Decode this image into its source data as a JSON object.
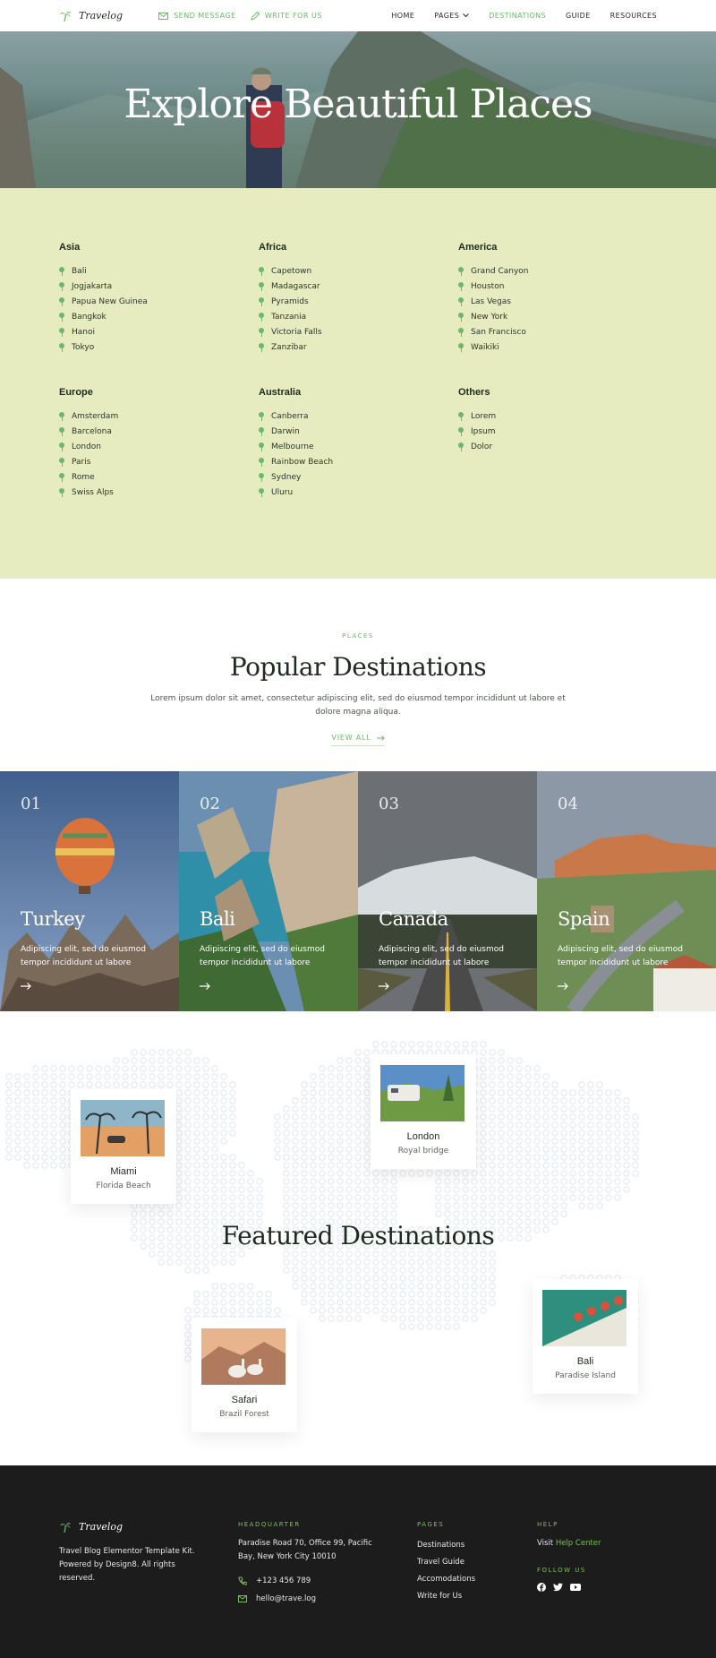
{
  "nav": {
    "brand": "Travelog",
    "actions": [
      {
        "label": "SEND MESSAGE",
        "icon": "envelope-icon"
      },
      {
        "label": "WRITE FOR US",
        "icon": "pencil-icon"
      }
    ],
    "links": [
      "HOME",
      "PAGES",
      "DESTINATIONS",
      "GUIDE",
      "RESOURCES"
    ],
    "active_link": "DESTINATIONS",
    "accent": "#6bb86a"
  },
  "hero": {
    "title": "Explore Beautiful Places"
  },
  "regions": [
    {
      "name": "Asia",
      "places": [
        "Bali",
        "Jogjakarta",
        "Papua New Guinea",
        "Bangkok",
        "Hanoi",
        "Tokyo"
      ]
    },
    {
      "name": "Africa",
      "places": [
        "Capetown",
        "Madagascar",
        "Pyramids",
        "Tanzania",
        "Victoria Falls",
        "Zanzibar"
      ]
    },
    {
      "name": "America",
      "places": [
        "Grand Canyon",
        "Houston",
        "Las Vegas",
        "New York",
        "San Francisco",
        "Waikiki"
      ]
    },
    {
      "name": "Europe",
      "places": [
        "Amsterdam",
        "Barcelona",
        "London",
        "Paris",
        "Rome",
        "Swiss Alps"
      ]
    },
    {
      "name": "Australia",
      "places": [
        "Canberra",
        "Darwin",
        "Melbourne",
        "Rainbow Beach",
        "Sydney",
        "Uluru"
      ]
    },
    {
      "name": "Others",
      "places": [
        "Lorem",
        "Ipsum",
        "Dolor"
      ]
    }
  ],
  "popular": {
    "eyebrow": "PLACES",
    "title": "Popular Destinations",
    "text": "Lorem ipsum dolor sit amet, consectetur adipiscing elit, sed do eiusmod tempor incididunt ut labore et dolore magna aliqua.",
    "view_all": "VIEW ALL",
    "cards": [
      {
        "num": "01",
        "name": "Turkey",
        "desc": "Adipiscing elit, sed do eiusmod tempor incididunt ut labore"
      },
      {
        "num": "02",
        "name": "Bali",
        "desc": "Adipiscing elit, sed do eiusmod tempor incididunt ut labore"
      },
      {
        "num": "03",
        "name": "Canada",
        "desc": "Adipiscing elit, sed do eiusmod tempor incididunt ut labore"
      },
      {
        "num": "04",
        "name": "Spain",
        "desc": "Adipiscing elit, sed do eiusmod tempor incididunt ut labore"
      }
    ]
  },
  "featured": {
    "title": "Featured Destinations",
    "cards": [
      {
        "title": "Miami",
        "sub": "Florida Beach"
      },
      {
        "title": "London",
        "sub": "Royal bridge"
      },
      {
        "title": "Bali",
        "sub": "Paradise Island"
      },
      {
        "title": "Safari",
        "sub": "Brazil Forest"
      }
    ]
  },
  "footer": {
    "brand": "Travelog",
    "about": "Travel Blog Elementor Template Kit. Powered by Design8. All rights reserved.",
    "hq_heading": "HEADQUARTER",
    "address": "Paradise Road 70, Office 99, Pacific Bay,  New York City 10010",
    "phone": "+123 456 789",
    "email": "hello@trave.log",
    "pages_heading": "PAGES",
    "pages": [
      "Destinations",
      "Travel Guide",
      "Accomodations",
      "Write for Us"
    ],
    "help_heading": "HELP",
    "help_prefix": "Visit",
    "help_link": "Help Center",
    "follow_heading": "FOLLOW US",
    "social": [
      "facebook-icon",
      "twitter-icon",
      "youtube-icon"
    ]
  }
}
